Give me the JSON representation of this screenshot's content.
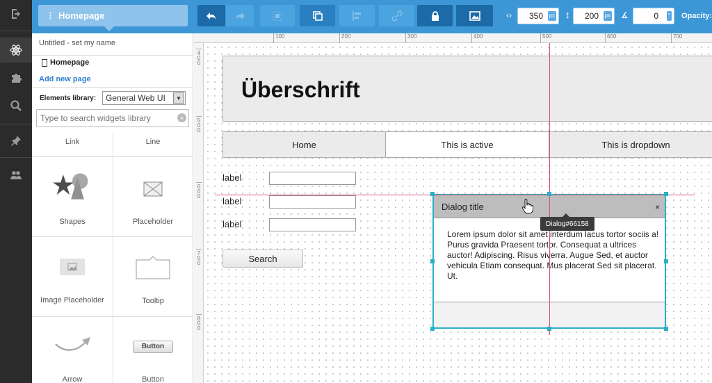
{
  "rail": {
    "items": [
      {
        "icon": "exit-icon"
      },
      {
        "icon": "atom-icon",
        "active": true
      },
      {
        "icon": "puzzle-icon"
      },
      {
        "icon": "search-icon"
      },
      {
        "icon": "pin-icon"
      },
      {
        "icon": "users-icon"
      }
    ]
  },
  "toolbar": {
    "page_tab": "Homepage",
    "width_value": "350",
    "height_value": "200",
    "angle_value": "0",
    "unit": "px",
    "opacity_label": "Opacity:"
  },
  "panel": {
    "project_name": "Untitled - set my name",
    "page_name": "Homepage",
    "add_page": "Add new page",
    "library_label": "Elements library:",
    "library_selected": "General Web UI",
    "search_placeholder": "Type to search widgets library",
    "widgets": [
      "Link",
      "Line",
      "Shapes",
      "Placeholder",
      "Image Placeholder",
      "Tooltip",
      "Arrow",
      "Button"
    ],
    "button_widget_text": "Button"
  },
  "canvas": {
    "ruler_top": [
      "100",
      "200",
      "300",
      "400",
      "500",
      "600",
      "700"
    ],
    "ruler_left": [
      "400",
      "500",
      "600",
      "700",
      "800"
    ],
    "heading": "Überschrift",
    "nav": [
      "Home",
      "This is active",
      "This is dropdown"
    ],
    "labels": [
      "label",
      "label",
      "label"
    ],
    "search_button": "Search",
    "dialog": {
      "title": "Dialog title",
      "close": "×",
      "body": "Lorem ipsum dolor sit amet interdum lacus tortor sociis a! Purus gravida Praesent tortor. Consequat a ultrices auctor! Adipiscing. Risus viverra. Augue Sed, et auctor vehicula Etiam consequat. Mus placerat Sed sit placerat. Ut.",
      "tooltip": "Dialog#66158"
    }
  },
  "colors": {
    "toolbar_blue": "#3d97d7",
    "selection_cyan": "#2ab0c6",
    "guide_red": "#d9536b",
    "rail_dark": "#2b2b2b"
  }
}
